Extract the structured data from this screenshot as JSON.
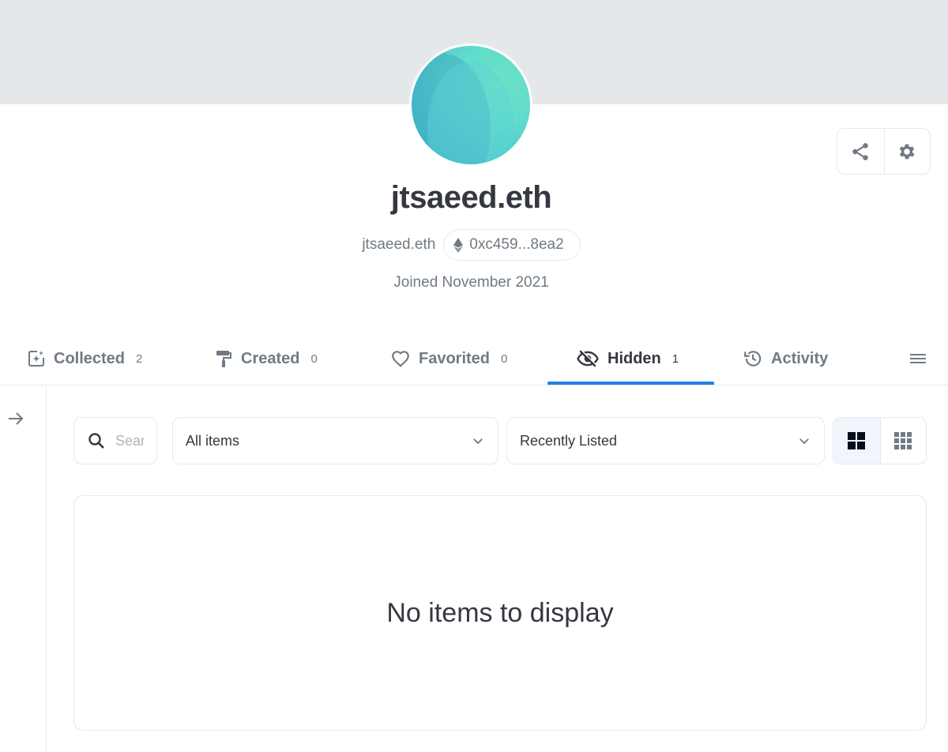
{
  "profile": {
    "name": "jtsaeed.eth",
    "ens_name": "jtsaeed.eth",
    "address": "0xc459...8ea2",
    "joined": "Joined November 2021"
  },
  "actions": [
    {
      "icon": "share-icon"
    },
    {
      "icon": "gear-icon"
    }
  ],
  "tabs": [
    {
      "label": "Collected",
      "count": "2",
      "icon": "collected-icon",
      "active": false
    },
    {
      "label": "Created",
      "count": "0",
      "icon": "paint-roller-icon",
      "active": false
    },
    {
      "label": "Favorited",
      "count": "0",
      "icon": "heart-icon",
      "active": false
    },
    {
      "label": "Hidden",
      "count": "1",
      "icon": "eye-off-icon",
      "active": true
    },
    {
      "label": "Activity",
      "count": "",
      "icon": "history-icon",
      "active": false
    },
    {
      "label": "",
      "count": "",
      "icon": "list-icon",
      "active": false
    }
  ],
  "filters": {
    "search_placeholder": "Search",
    "items_select": "All items",
    "sort_select": "Recently Listed"
  },
  "view_modes": [
    {
      "icon": "large-grid-icon",
      "active": true
    },
    {
      "icon": "small-grid-icon",
      "active": false
    }
  ],
  "empty_state": "No items to display",
  "colors": {
    "accent": "#2081e2",
    "text": "#353840",
    "muted": "#707a83",
    "border": "#e5e8eb",
    "banner": "#e5e8eb"
  }
}
